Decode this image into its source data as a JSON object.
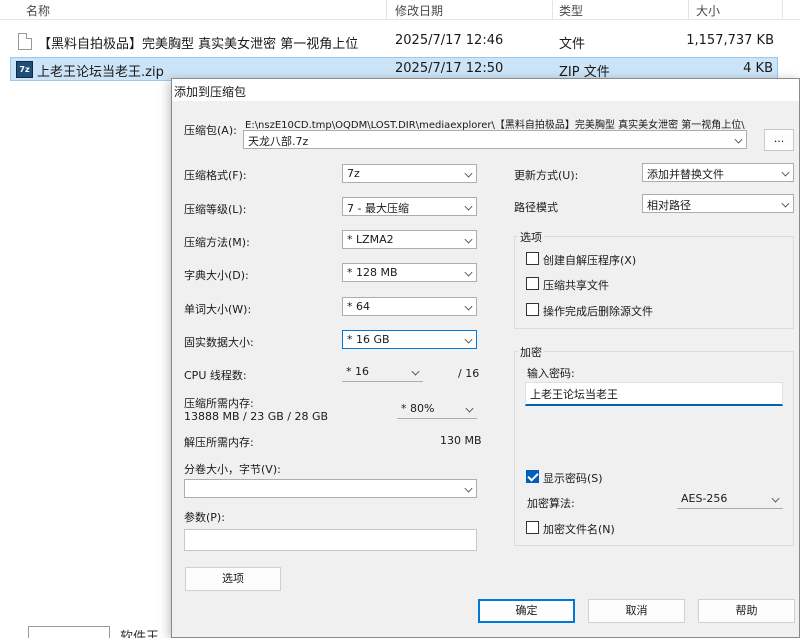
{
  "explorer": {
    "columns": {
      "name": "名称",
      "date": "修改日期",
      "type": "类型",
      "size": "大小"
    },
    "files": [
      {
        "name": "【黑料自拍极品】完美胸型 真实美女泄密 第一视角上位",
        "date": "2025/7/17 12:46",
        "type": "文件",
        "size": "1,157,737 KB",
        "icon": "folder-file-icon"
      },
      {
        "name": "上老王论坛当老王.zip",
        "date": "2025/7/17 12:50",
        "type": "ZIP 文件",
        "size": "4 KB",
        "icon": "7z-archive-icon",
        "icon_text": "7z"
      }
    ],
    "bottom_text": "软件王"
  },
  "dialog": {
    "title": "添加到压缩包",
    "archive": {
      "label": "压缩包(A):",
      "path": "E:\\nszE10CD.tmp\\OQDM\\LOST.DIR\\mediaexplorer\\【黑料自拍极品】完美胸型 真实美女泄密 第一视角上位\\",
      "filename": "天龙八部.7z",
      "browse_label": "..."
    },
    "format": {
      "label": "压缩格式(F):",
      "value": "7z"
    },
    "level": {
      "label": "压缩等级(L):",
      "value": "7 - 最大压缩"
    },
    "method": {
      "label": "压缩方法(M):",
      "value": "* LZMA2"
    },
    "dict": {
      "label": "字典大小(D):",
      "value": "* 128 MB"
    },
    "word": {
      "label": "单词大小(W):",
      "value": "* 64"
    },
    "solid": {
      "label": "固实数据大小:",
      "value": "* 16 GB"
    },
    "cpu": {
      "label": "CPU 线程数:",
      "value": "* 16",
      "total": "/ 16"
    },
    "mem": {
      "label": "压缩所需内存:",
      "detail": "13888 MB / 23 GB / 28 GB",
      "value": "* 80%"
    },
    "decomp": {
      "label": "解压所需内存:",
      "value": "130 MB"
    },
    "split": {
      "label": "分卷大小，字节(V):",
      "value": ""
    },
    "params": {
      "label": "参数(P):",
      "value": ""
    },
    "options_button": "选项",
    "update": {
      "label": "更新方式(U):",
      "value": "添加并替换文件"
    },
    "path_mode": {
      "label": "路径模式",
      "value": "相对路径"
    },
    "options_group": {
      "title": "选项",
      "items": [
        {
          "label": "创建自解压程序(X)",
          "checked": false
        },
        {
          "label": "压缩共享文件",
          "checked": false
        },
        {
          "label": "操作完成后删除源文件",
          "checked": false
        }
      ]
    },
    "encrypt_group": {
      "title": "加密",
      "password_label": "输入密码:",
      "password": "上老王论坛当老王",
      "show_password": "显示密码(S)",
      "method_label": "加密算法:",
      "method_value": "AES-256",
      "encrypt_names": "加密文件名(N)"
    },
    "buttons": {
      "ok": "确定",
      "cancel": "取消",
      "help": "帮助"
    },
    "accent_color": "#0078d7"
  }
}
